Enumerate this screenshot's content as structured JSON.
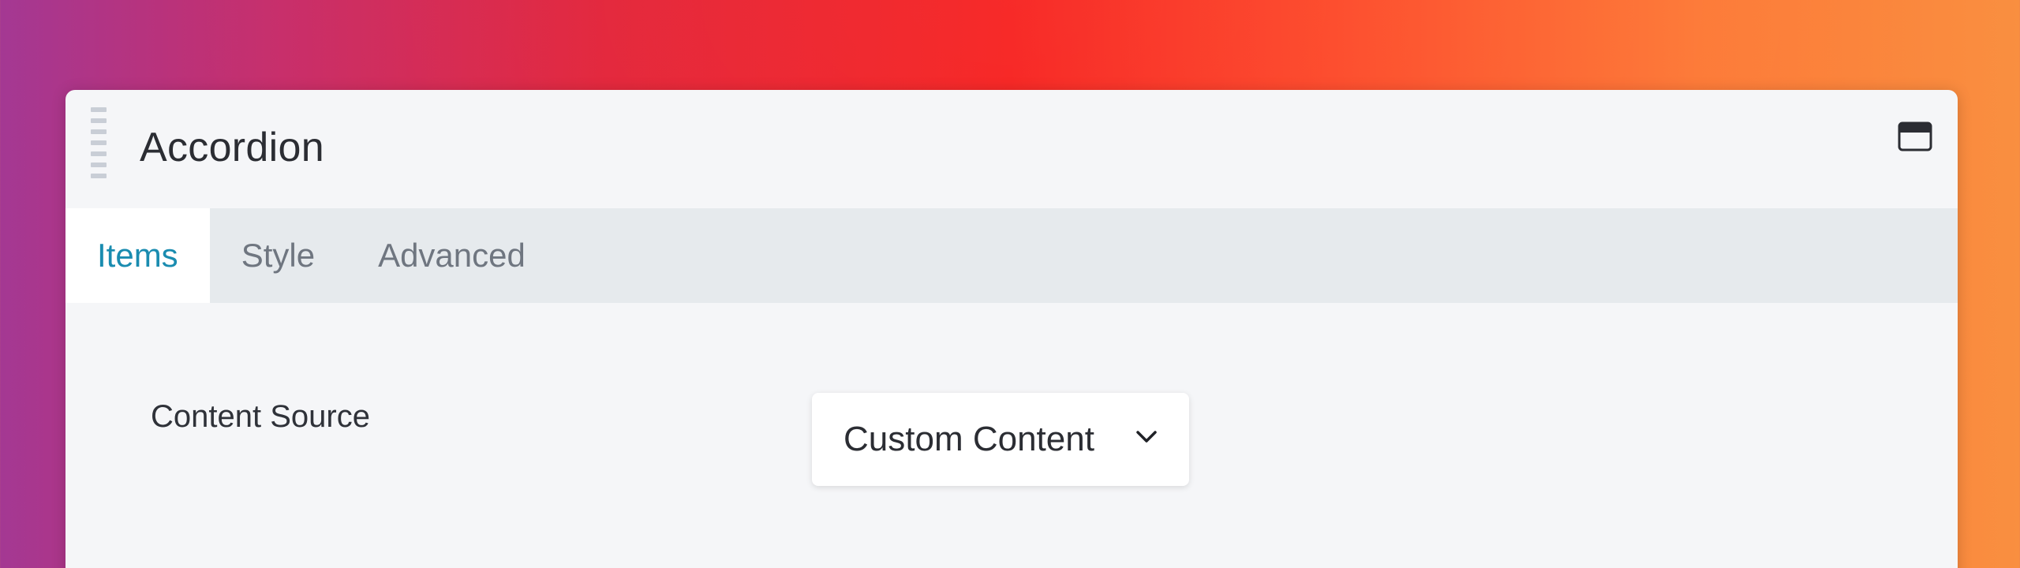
{
  "panel": {
    "title": "Accordion"
  },
  "tabs": [
    {
      "label": "Items",
      "active": true
    },
    {
      "label": "Style",
      "active": false
    },
    {
      "label": "Advanced",
      "active": false
    }
  ],
  "fields": {
    "content_source": {
      "label": "Content Source",
      "value": "Custom Content"
    }
  },
  "colors": {
    "accent": "#1a8cb0",
    "panel_bg": "#f5f6f8",
    "tabbar_bg": "#e6eaed"
  },
  "icons": {
    "drag": "drag-handle-icon",
    "window": "window-icon",
    "dropdown": "chevron-down-icon"
  }
}
